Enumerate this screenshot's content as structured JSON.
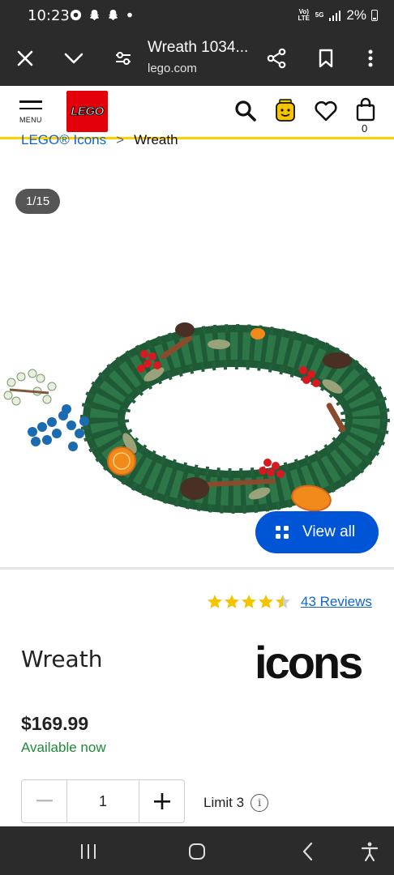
{
  "status_bar": {
    "time": "10:23",
    "notifications": [
      "chrome-icon",
      "snapchat-icon",
      "snapchat-icon",
      "dot"
    ],
    "network": "Vo) LTE",
    "network_gen": "5G",
    "battery": "2%"
  },
  "browser": {
    "title": "Wreath 1034...",
    "domain": "lego.com"
  },
  "header": {
    "menu_label": "MENU",
    "logo_text": "LEGO",
    "cart_count": "0"
  },
  "breadcrumb": {
    "parent": "LEGO® Icons",
    "separator": ">",
    "current": "Wreath"
  },
  "gallery": {
    "counter": "1/15",
    "view_all_label": "View all"
  },
  "product": {
    "rating": 4.5,
    "reviews_label": "43 Reviews",
    "name": "Wreath",
    "brand_logo_text": "icons",
    "price": "$169.99",
    "availability": "Available now",
    "quantity": "1",
    "limit_label": "Limit 3",
    "info_symbol": "i"
  },
  "colors": {
    "accent_blue": "#0055d6",
    "lego_red": "#e3000b",
    "header_yellow": "#ffcf00",
    "available_green": "#1e8a3a",
    "star_yellow": "#f5c400"
  }
}
